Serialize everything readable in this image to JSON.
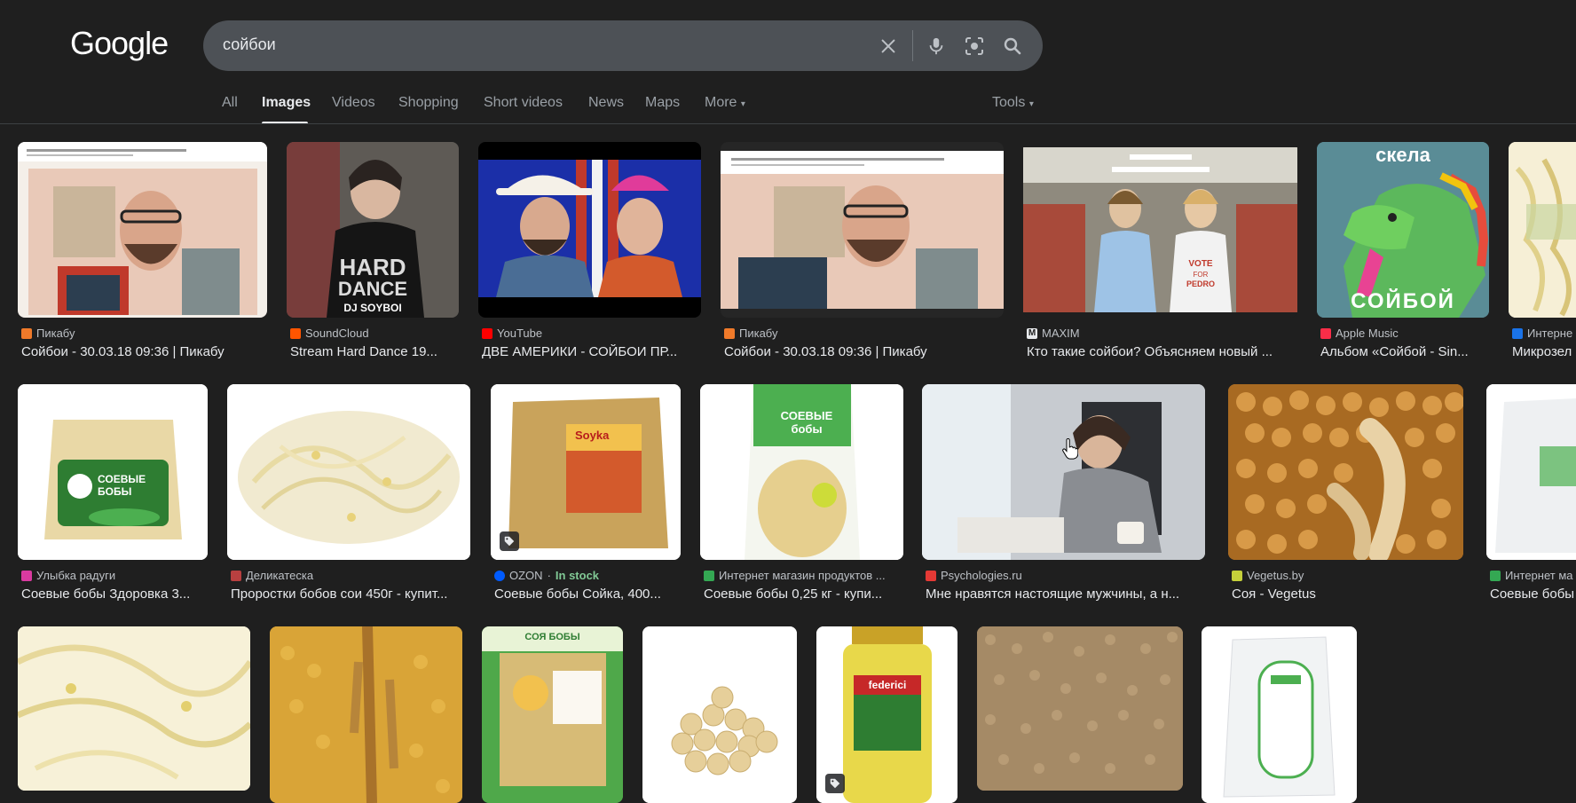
{
  "header": {
    "logo_text": "Google",
    "query": "сойбои"
  },
  "tabs": [
    {
      "label": "All"
    },
    {
      "label": "Images"
    },
    {
      "label": "Videos"
    },
    {
      "label": "Shopping"
    },
    {
      "label": "Short videos"
    },
    {
      "label": "News"
    },
    {
      "label": "Maps"
    },
    {
      "label": "More"
    }
  ],
  "tools_label": "Tools",
  "results": {
    "row1": [
      {
        "source": "Пикабу",
        "title": "Сойбои - 30.03.18 09:36 | Пикабу",
        "favicon_color": "#f07a2a"
      },
      {
        "source": "SoundCloud",
        "title": "Stream Hard Dance 19...",
        "favicon_color": "#ff5500"
      },
      {
        "source": "YouTube",
        "title": "ДВЕ АМЕРИКИ - СОЙБОИ ПР...",
        "favicon_color": "#ff0000"
      },
      {
        "source": "Пикабу",
        "title": "Сойбои - 30.03.18 09:36 | Пикабу",
        "favicon_color": "#f07a2a"
      },
      {
        "source": "MAXIM",
        "title": "Кто такие сойбои? Объясняем новый ...",
        "favicon_color": "#1f1f1f"
      },
      {
        "source": "Apple Music",
        "title": "Альбом «Сойбой - Sin...",
        "favicon_color": "#fa2d48"
      },
      {
        "source": "Интерне",
        "title": "Микрозел",
        "favicon_color": "#1a73e8"
      }
    ],
    "row2": [
      {
        "source": "Улыбка радуги",
        "title": "Соевые бобы Здоровка 3...",
        "favicon_color": "#d93aa0"
      },
      {
        "source": "Деликатеска",
        "title": "Проростки бобов сои 450г - купит...",
        "favicon_color": "#b84040"
      },
      {
        "source": "OZON",
        "stock": "In stock",
        "title": "Соевые бобы Сойка, 400...",
        "favicon_color": "#005bff"
      },
      {
        "source": "Интернет магазин продуктов ...",
        "title": "Соевые бобы 0,25 кг - купи...",
        "favicon_color": "#34a853"
      },
      {
        "source": "Psychologies.ru",
        "title": "Мне нравятся настоящие мужчины, а н...",
        "favicon_color": "#e53935"
      },
      {
        "source": "Vegetus.by",
        "title": "Соя - Vegetus",
        "favicon_color": "#c5d03a"
      },
      {
        "source": "Интернет ма",
        "title": "Соевые бобы",
        "favicon_color": "#34a853"
      }
    ]
  },
  "thumbnails": {
    "r1c2": "DJ SOYBOI",
    "r1c6_top": "скела",
    "r1c6_bottom": "СОЙБОЙ",
    "r2c1": "СОЕВЫЕ БОБЫ",
    "r2c3": "Soyka",
    "r2c4": "СОЕВЫЕ бобы",
    "r3c3": "СОЯ БОБЫ",
    "r3c5": "federici"
  },
  "colors": {
    "background": "#1f1f1f",
    "searchbox": "#4d5156",
    "in_stock": "#81c995"
  }
}
